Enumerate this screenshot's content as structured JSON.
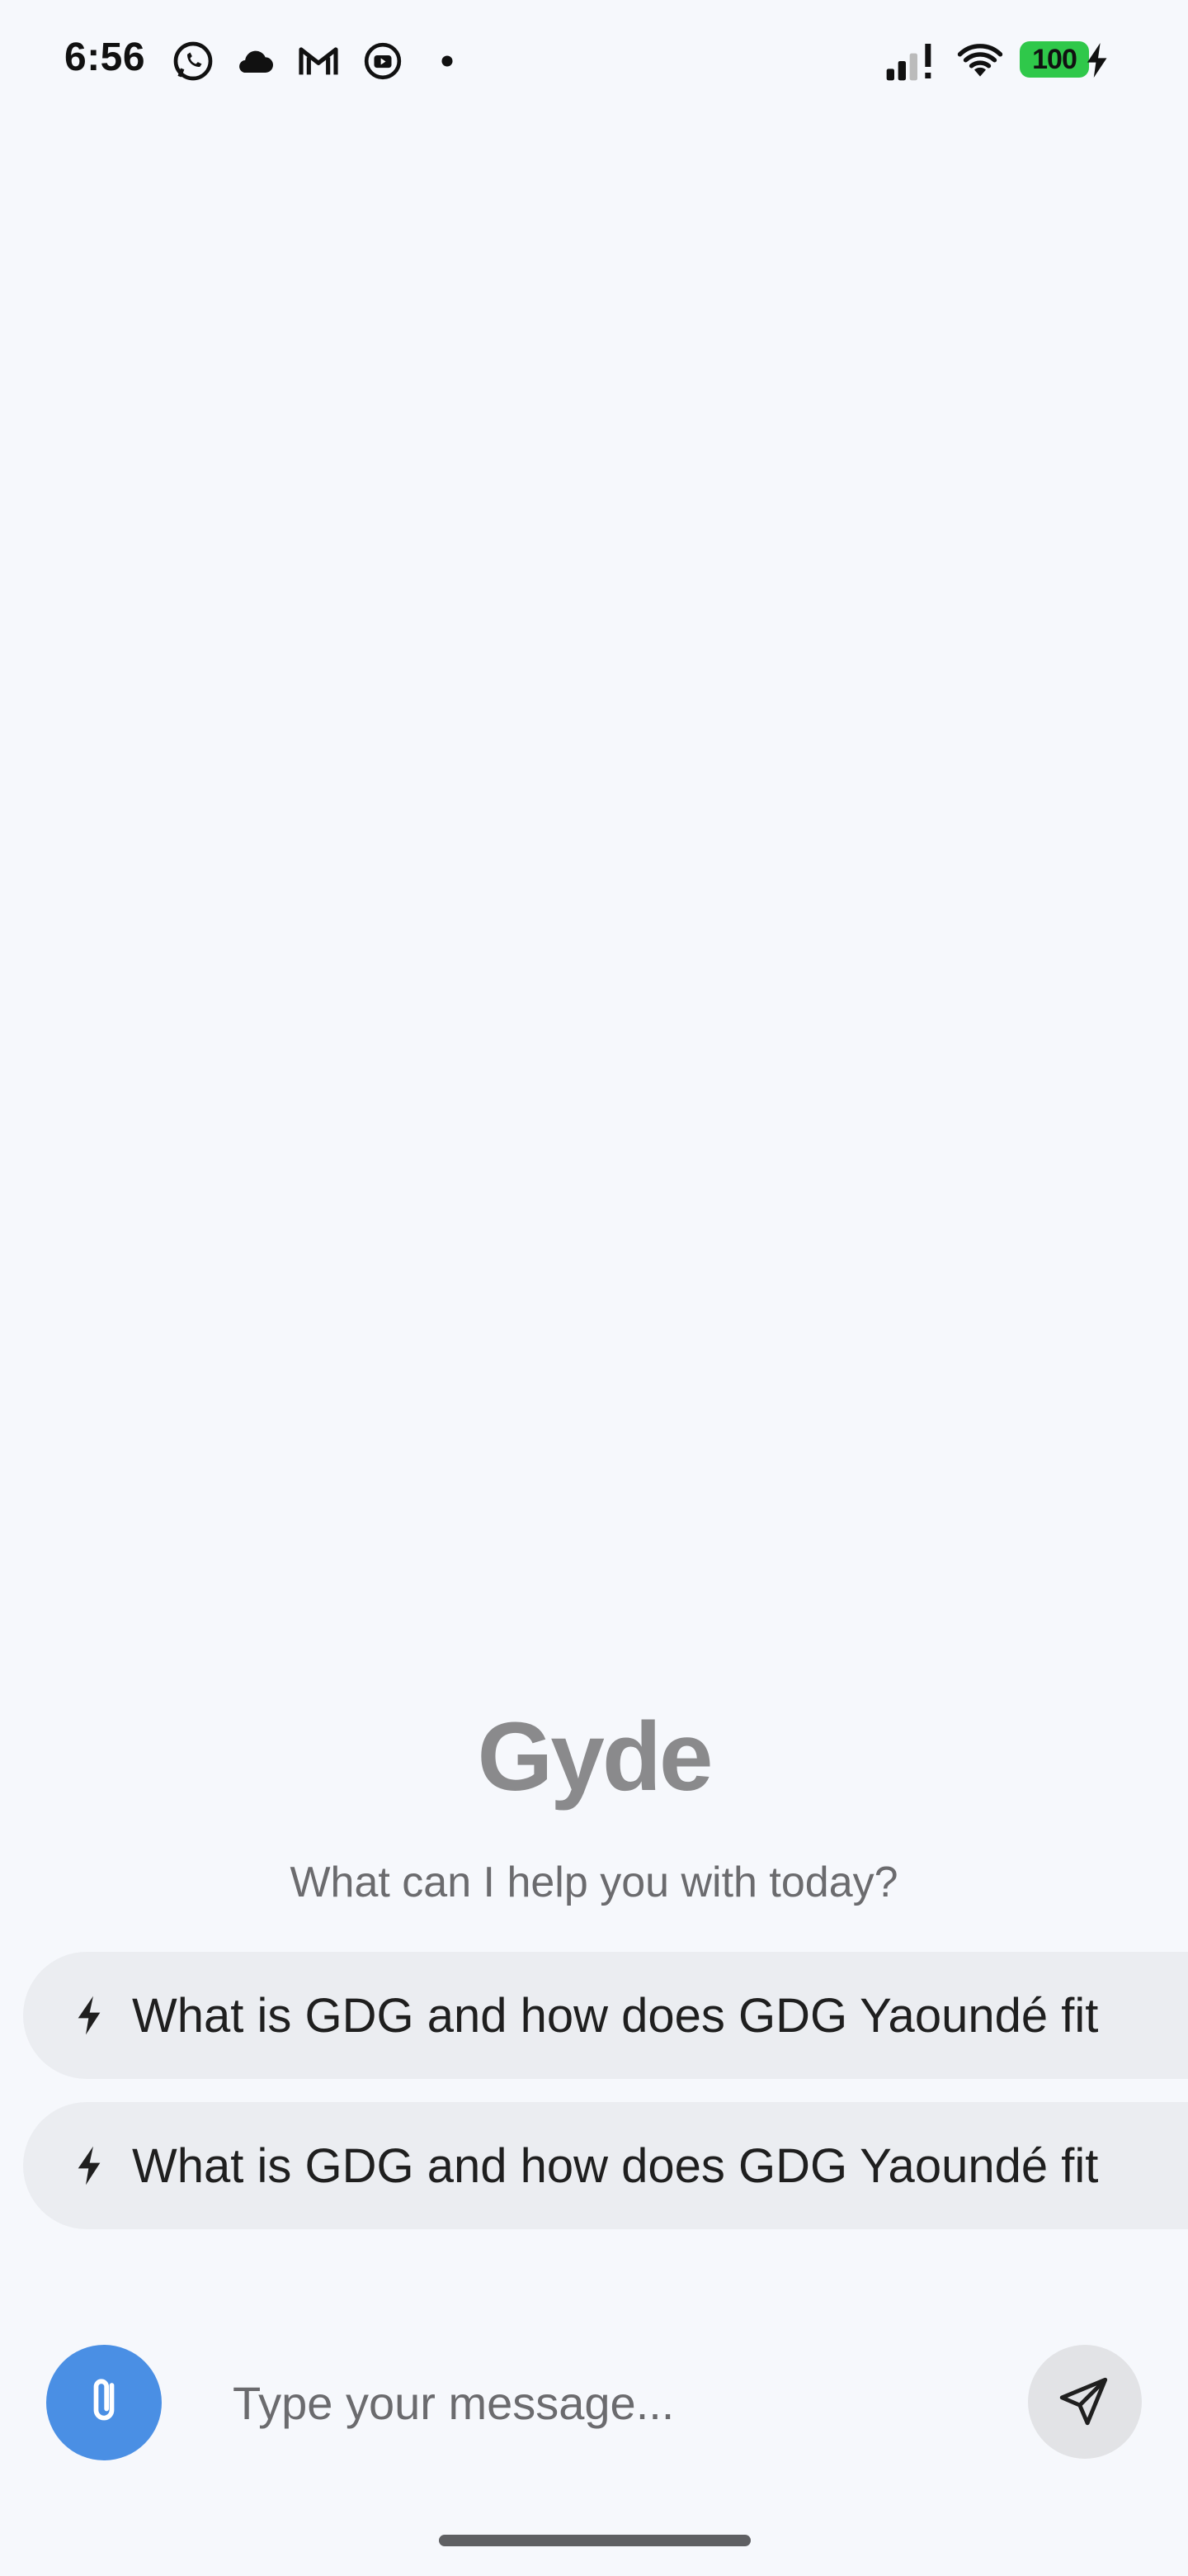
{
  "status_bar": {
    "time": "6:56",
    "battery": "100",
    "notification_icons": [
      "whatsapp-icon",
      "cloud-icon",
      "gmail-icon",
      "youtube-icon",
      "dot-icon"
    ],
    "system_icons": [
      "signal-icon",
      "wifi-icon",
      "battery-icon",
      "charging-icon"
    ]
  },
  "brand": {
    "title": "Gyde",
    "subtitle": "What can I help you with today?"
  },
  "suggestions": [
    {
      "icon": "bolt-icon",
      "label": "What is GDG and how does GDG Yaoundé fit"
    },
    {
      "icon": "bolt-icon",
      "label": "What is GDG and how does GDG Yaoundé fit"
    }
  ],
  "composer": {
    "placeholder": "Type your message...",
    "attach_icon": "paperclip-icon",
    "send_icon": "send-icon"
  },
  "colors": {
    "background": "#f6f8fc",
    "accent": "#4a8fe4",
    "chip": "#ebedf1",
    "battery": "#2fc84a"
  }
}
